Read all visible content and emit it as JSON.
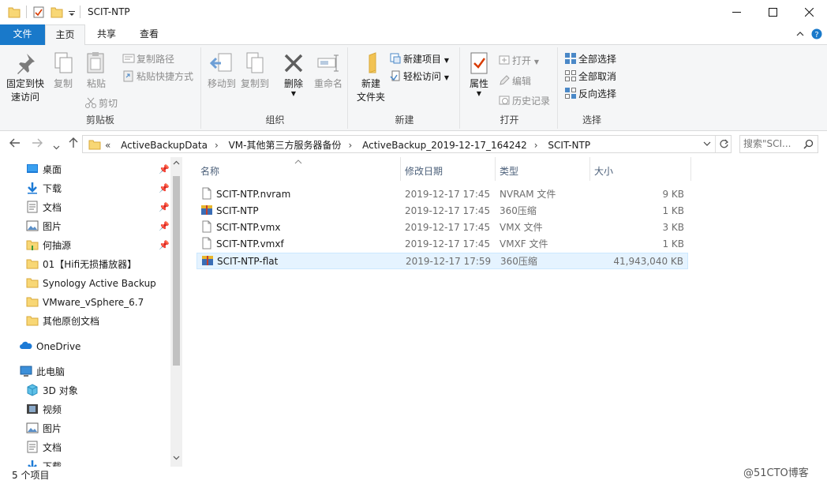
{
  "window": {
    "title": "SCIT-NTP",
    "accent": "#1979ca"
  },
  "tabs": {
    "file": "文件",
    "home": "主页",
    "share": "共享",
    "view": "查看"
  },
  "ribbon": {
    "clipboard": {
      "label": "剪贴板",
      "pin_quick_access": "固定到快",
      "pin_quick_access_2": "速访问",
      "copy": "复制",
      "paste": "粘贴",
      "copy_path": "复制路径",
      "paste_shortcut": "粘贴快捷方式",
      "cut": "剪切"
    },
    "organize": {
      "label": "组织",
      "move_to": "移动到",
      "copy_to": "复制到",
      "delete": "删除",
      "rename": "重命名"
    },
    "new": {
      "label": "新建",
      "new_folder": "新建",
      "new_folder_2": "文件夹",
      "new_item": "新建项目",
      "easy_access": "轻松访问"
    },
    "open": {
      "label": "打开",
      "properties": "属性",
      "open": "打开",
      "edit": "编辑",
      "history": "历史记录"
    },
    "select": {
      "label": "选择",
      "select_all": "全部选择",
      "select_none": "全部取消",
      "invert": "反向选择"
    }
  },
  "address": {
    "overflow": "«",
    "crumbs": [
      "ActiveBackupData",
      "VM-其他第三方服务器备份",
      "ActiveBackup_2019-12-17_164242",
      "SCIT-NTP"
    ]
  },
  "search": {
    "placeholder": "搜索\"SCI..."
  },
  "navpane": {
    "quick_access": [
      {
        "label": "桌面",
        "icon": "desktop-icon",
        "pinned": true
      },
      {
        "label": "下载",
        "icon": "download-icon",
        "pinned": true
      },
      {
        "label": "文档",
        "icon": "document-icon",
        "pinned": true
      },
      {
        "label": "图片",
        "icon": "picture-icon",
        "pinned": true
      },
      {
        "label": "何抽源",
        "icon": "user-folder-icon",
        "pinned": true
      },
      {
        "label": "01【Hifi无损播放器】",
        "icon": "folder-icon",
        "pinned": false
      },
      {
        "label": "Synology Active Backup",
        "icon": "folder-icon",
        "pinned": false
      },
      {
        "label": "VMware_vSphere_6.7",
        "icon": "folder-icon",
        "pinned": false
      },
      {
        "label": "其他原创文档",
        "icon": "folder-icon",
        "pinned": false
      }
    ],
    "onedrive": "OneDrive",
    "this_pc": "此电脑",
    "pc_items": [
      {
        "label": "3D 对象",
        "icon": "3d-objects-icon"
      },
      {
        "label": "视频",
        "icon": "video-icon"
      },
      {
        "label": "图片",
        "icon": "picture-icon"
      },
      {
        "label": "文档",
        "icon": "document-icon"
      },
      {
        "label": "下载",
        "icon": "download-icon"
      }
    ]
  },
  "columns": {
    "name": "名称",
    "date": "修改日期",
    "type": "类型",
    "size": "大小"
  },
  "files": [
    {
      "name": "SCIT-NTP.nvram",
      "date": "2019-12-17 17:45",
      "type": "NVRAM 文件",
      "size": "9 KB",
      "icon": "file-icon",
      "selected": false
    },
    {
      "name": "SCIT-NTP",
      "date": "2019-12-17 17:45",
      "type": "360压缩",
      "size": "1 KB",
      "icon": "archive-icon",
      "selected": false
    },
    {
      "name": "SCIT-NTP.vmx",
      "date": "2019-12-17 17:45",
      "type": "VMX 文件",
      "size": "3 KB",
      "icon": "file-icon",
      "selected": false
    },
    {
      "name": "SCIT-NTP.vmxf",
      "date": "2019-12-17 17:45",
      "type": "VMXF 文件",
      "size": "1 KB",
      "icon": "file-icon",
      "selected": false
    },
    {
      "name": "SCIT-NTP-flat",
      "date": "2019-12-17 17:59",
      "type": "360压缩",
      "size": "41,943,040 KB",
      "icon": "archive-icon",
      "selected": true
    }
  ],
  "status": {
    "count": "5 个项目"
  },
  "watermark": "@51CTO博客"
}
